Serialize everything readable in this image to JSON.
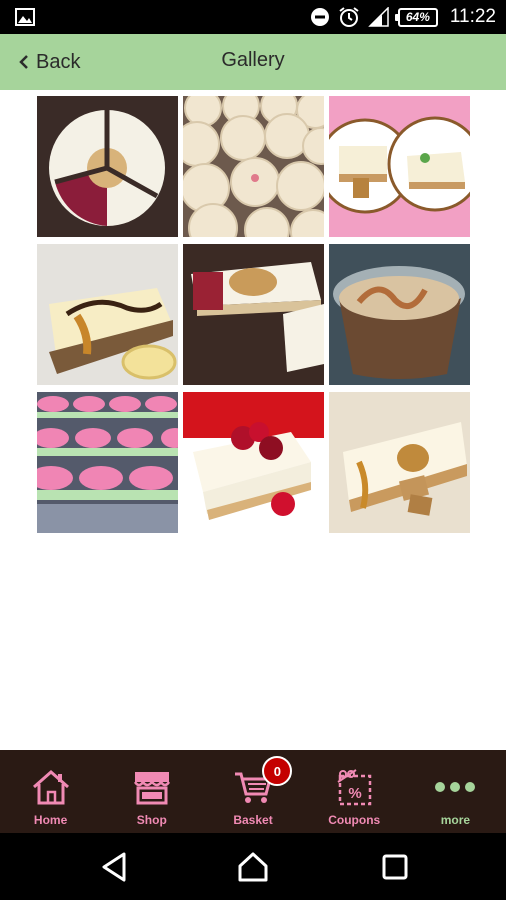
{
  "status_bar": {
    "time": "11:22",
    "battery_percent": "64%",
    "icons": [
      "image-icon",
      "do-not-disturb-icon",
      "alarm-icon",
      "signal-icon",
      "battery-icon"
    ]
  },
  "header": {
    "back_label": "Back",
    "title": "Gallery",
    "background_color": "#a6d49b"
  },
  "gallery": {
    "items": [
      {
        "subject": "cheesecake-slices-with-raspberry-swirl"
      },
      {
        "subject": "cupcakes-with-cream-frosting"
      },
      {
        "subject": "caramel-cheesecake-collage"
      },
      {
        "subject": "banana-caramel-cheesecake-slice"
      },
      {
        "subject": "raspberry-and-caramel-cheesecake-slices"
      },
      {
        "subject": "caramel-dessert-in-plastic-cup"
      },
      {
        "subject": "pink-mini-cheesecakes-tray"
      },
      {
        "subject": "raspberry-cheesecake-slice"
      },
      {
        "subject": "caramel-fudge-cheesecake-slice"
      }
    ]
  },
  "tab_bar": {
    "background_color": "#2a1a14",
    "accent_color": "#f08ab4",
    "tabs": [
      {
        "label": "Home",
        "icon": "home-icon"
      },
      {
        "label": "Shop",
        "icon": "shop-icon"
      },
      {
        "label": "Basket",
        "icon": "cart-icon",
        "badge": "0"
      },
      {
        "label": "Coupons",
        "icon": "coupon-icon"
      },
      {
        "label": "more",
        "icon": "more-dots-icon"
      }
    ]
  },
  "nav_bar": {
    "buttons": [
      "back-triangle-icon",
      "home-circle-icon",
      "recents-square-icon"
    ]
  }
}
